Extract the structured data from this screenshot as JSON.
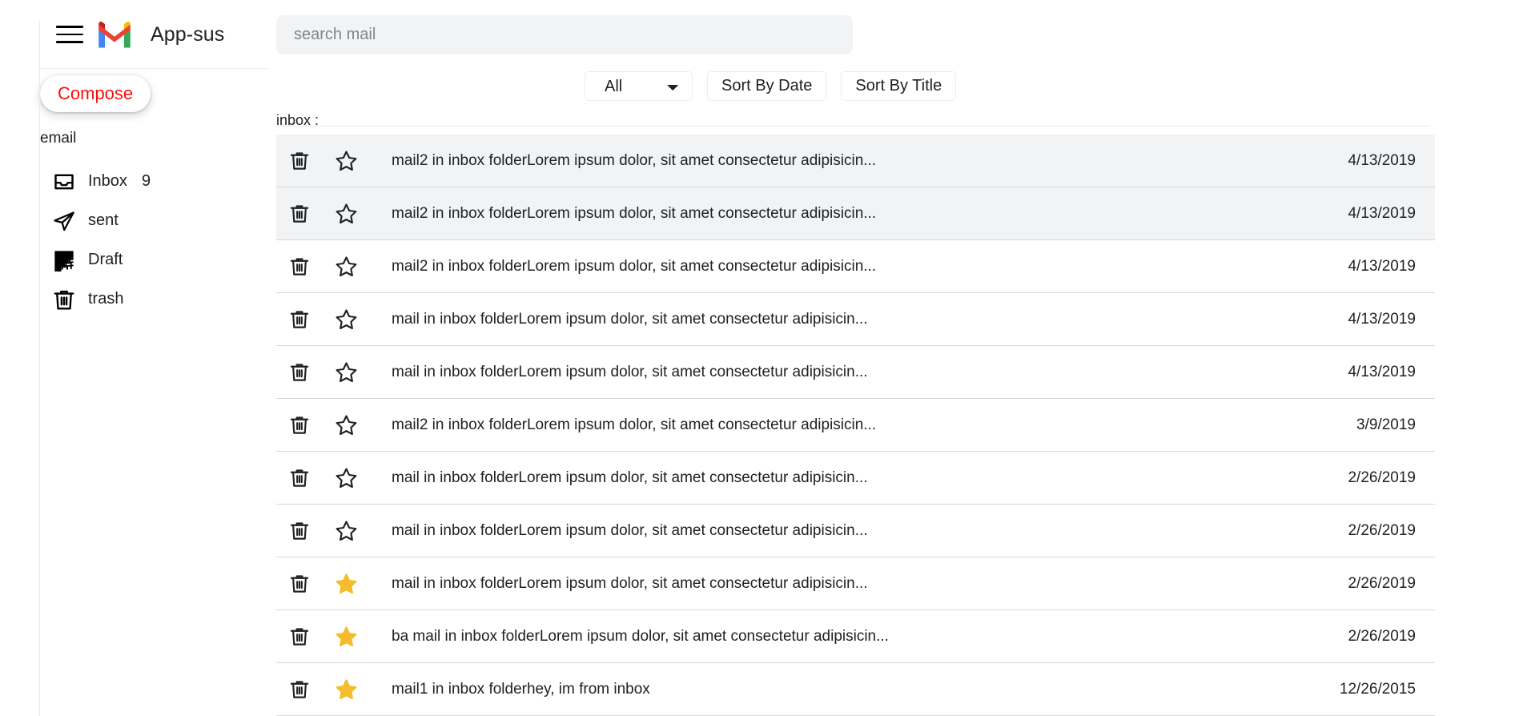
{
  "app": {
    "title": "App-sus",
    "logo_icon": "gmail-logo-icon",
    "menu_icon": "hamburger-menu-icon"
  },
  "sidebar": {
    "compose_label": "Compose",
    "section_label": "email",
    "items": [
      {
        "label": "Inbox",
        "count": "9",
        "icon": "inbox-icon"
      },
      {
        "label": "sent",
        "count": "",
        "icon": "send-icon"
      },
      {
        "label": "Draft",
        "count": "",
        "icon": "draft-icon"
      },
      {
        "label": "trash",
        "count": "",
        "icon": "trash-icon"
      }
    ]
  },
  "search": {
    "value": "",
    "placeholder": "search mail"
  },
  "controls": {
    "filter_selected": "All",
    "filter_options": [
      "All"
    ],
    "sort_by_date_label": "Sort By Date",
    "sort_by_title_label": "Sort By Title"
  },
  "list": {
    "header": "inbox :",
    "rows": [
      {
        "subject": "mail2 in inbox folderLorem ipsum dolor, sit amet consectetur adipisicin...",
        "date": "4/13/2019",
        "starred": false,
        "unread": true
      },
      {
        "subject": "mail2 in inbox folderLorem ipsum dolor, sit amet consectetur adipisicin...",
        "date": "4/13/2019",
        "starred": false,
        "unread": true
      },
      {
        "subject": "mail2 in inbox folderLorem ipsum dolor, sit amet consectetur adipisicin...",
        "date": "4/13/2019",
        "starred": false,
        "unread": false
      },
      {
        "subject": "mail in inbox folderLorem ipsum dolor, sit amet consectetur adipisicin...",
        "date": "4/13/2019",
        "starred": false,
        "unread": false
      },
      {
        "subject": "mail in inbox folderLorem ipsum dolor, sit amet consectetur adipisicin...",
        "date": "4/13/2019",
        "starred": false,
        "unread": false
      },
      {
        "subject": "mail2 in inbox folderLorem ipsum dolor, sit amet consectetur adipisicin...",
        "date": "3/9/2019",
        "starred": false,
        "unread": false
      },
      {
        "subject": "mail in inbox folderLorem ipsum dolor, sit amet consectetur adipisicin...",
        "date": "2/26/2019",
        "starred": false,
        "unread": false
      },
      {
        "subject": "mail in inbox folderLorem ipsum dolor, sit amet consectetur adipisicin...",
        "date": "2/26/2019",
        "starred": false,
        "unread": false
      },
      {
        "subject": "mail in inbox folderLorem ipsum dolor, sit amet consectetur adipisicin...",
        "date": "2/26/2019",
        "starred": true,
        "unread": false
      },
      {
        "subject": "ba mail in inbox folderLorem ipsum dolor, sit amet consectetur adipisicin...",
        "date": "2/26/2019",
        "starred": true,
        "unread": false
      },
      {
        "subject": "mail1 in inbox folderhey, im from inbox",
        "date": "12/26/2015",
        "starred": true,
        "unread": false
      }
    ]
  },
  "colors": {
    "compose_text": "#fb0d0d",
    "star_filled": "#f5bc2b",
    "unread_row_bg": "#f1f3f4",
    "search_bg": "#f1f3f4"
  }
}
